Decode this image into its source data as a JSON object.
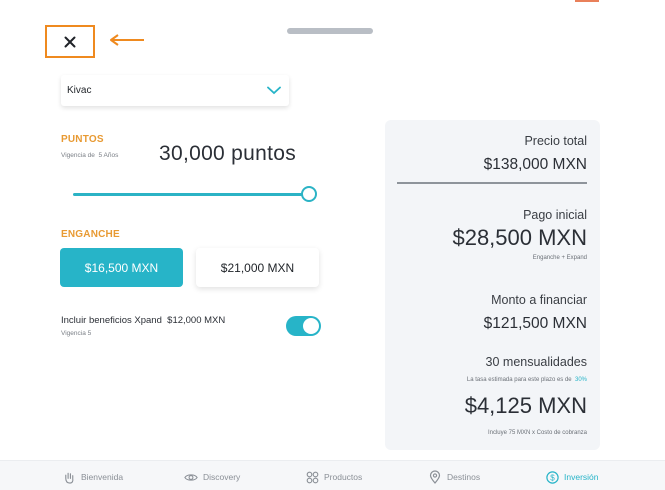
{
  "colors": {
    "accent": "#27b4c8",
    "label_orange": "#e89a33",
    "annotation_orange": "#ef8a1f",
    "card_bg": "#f3f5f8"
  },
  "select": {
    "value": "Kivac",
    "icon": "chevron-down-icon"
  },
  "points": {
    "label": "PUNTOS",
    "vigencia_prefix": "Vigencia de",
    "vigencia_value": "5 Años",
    "value_text": "30,000 puntos",
    "slider_level": 1.0
  },
  "enganche": {
    "label": "ENGANCHE",
    "options": [
      "$16,500 MXN",
      "$21,000 MXN"
    ],
    "selected_index": 0
  },
  "xpand": {
    "label": "Incluir beneficios Xpand",
    "price": "$12,000 MXN",
    "vigencia": "Vigencia 5",
    "enabled": true
  },
  "summary": {
    "precio_total_label": "Precio total",
    "precio_total": "$138,000 MXN",
    "pago_inicial_label": "Pago inicial",
    "pago_inicial": "$28,500 MXN",
    "pago_inicial_note": "Enganche + Expand",
    "monto_label": "Monto a financiar",
    "monto": "$121,500 MXN",
    "mensualidades_label": "30 mensualidades",
    "tasa_text": "La tasa estimada para este plazo es de",
    "tasa_value": "30%",
    "mensualidad": "$4,125 MXN",
    "mensualidad_note": "Incluye 75 MXN x Costo de cobranza"
  },
  "nav": {
    "items": [
      {
        "label": "Bienvenida",
        "icon": "hand-icon"
      },
      {
        "label": "Discovery",
        "icon": "eye-icon"
      },
      {
        "label": "Productos",
        "icon": "grid-icon"
      },
      {
        "label": "Destinos",
        "icon": "location-pin-icon"
      },
      {
        "label": "Inversión",
        "icon": "dollar-circle-icon"
      }
    ],
    "active_index": 4
  }
}
